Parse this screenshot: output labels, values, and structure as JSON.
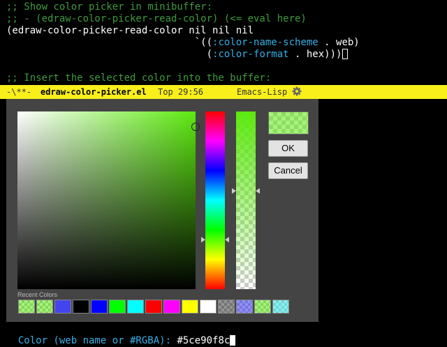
{
  "code": {
    "line1": ";; Show color picker in minibuffer:",
    "line2": ";; - (edraw-color-picker-read-color) (<= eval here)",
    "line3": "(edraw-color-picker-read-color nil nil nil",
    "line4_pre": "                                `((",
    "line4_kw": ":color-name-scheme",
    "line4_post": " . web)",
    "line5_pre": "                                  (",
    "line5_kw": ":color-format",
    "line5_post": " . hex)))",
    "line7": ";; Insert the selected color into the buffer:"
  },
  "modeline": {
    "status": "-\\**-",
    "buffer_name": "edraw-color-picker.el",
    "position": "Top 29:56",
    "mode": "Emacs-Lisp",
    "icon": "gear-icon"
  },
  "picker": {
    "current_color": "#5ce90f8c",
    "ok_label": "OK",
    "cancel_label": "Cancel",
    "recent_label": "Recent Colors",
    "recent_colors": [
      "rgba(92,233,15,0.55)",
      "rgba(92,233,15,0.55)",
      "#4444ee",
      "#000000",
      "#0000ff",
      "#00ff00",
      "#00ffff",
      "#ff0000",
      "#ff00ff",
      "#ffff00",
      "#ffffff",
      "rgba(60,60,60,0.55)",
      "rgba(70,70,240,0.6)",
      "rgba(92,233,15,0.55)",
      "rgba(60,230,230,0.6)"
    ]
  },
  "minibuffer": {
    "prompt": "Color (web name or #RGBA): ",
    "value": "#5ce90f8c"
  }
}
